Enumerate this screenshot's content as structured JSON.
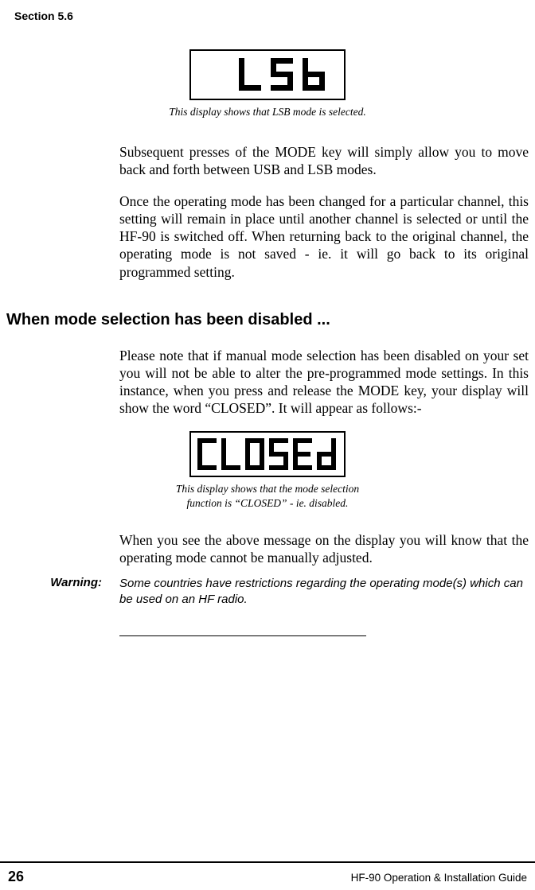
{
  "sectionLabel": "Section 5.6",
  "caption1": "This display shows that LSB mode is selected.",
  "para1": "Subsequent presses of the MODE key will simply allow you to move back and forth between USB and LSB modes.",
  "para2": "Once the operating mode has been changed for a particular channel, this setting will remain in place until another channel is selected or until the HF-90 is switched off.  When returning back to the original channel, the operating mode is not saved - ie. it will go back to its original programmed setting.",
  "heading": "When mode selection has been disabled ...",
  "para3": "Please note that if manual mode selection has been disabled on your set you will not be able to alter the pre-programmed mode settings.  In this instance, when you press and release the MODE key, your display will show the word “CLOSED”.  It will appear as follows:-",
  "caption2a": "This display shows that the mode selection",
  "caption2b": "function is “CLOSED” - ie. disabled.",
  "para4": "When you see the above message on the display you will know that the operating mode cannot be manually adjusted.",
  "warningLabel": "Warning:",
  "warningText": "Some countries have restrictions regarding the operating mode(s) which can be used on an HF radio.",
  "pageNumber": "26",
  "guideName": "HF-90 Operation & Installation Guide"
}
